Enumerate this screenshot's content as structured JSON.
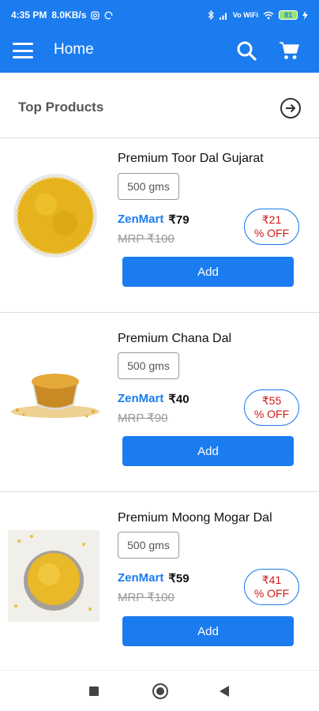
{
  "status_bar": {
    "time": "4:35 PM",
    "speed": "8.0KB/s",
    "network": "Vo WiFi",
    "battery": "81"
  },
  "app_bar": {
    "title": "Home"
  },
  "section": {
    "title": "Top Products"
  },
  "colors": {
    "primary": "#1b7cf0",
    "discount": "#d01818"
  },
  "products": [
    {
      "name": "Premium Toor Dal Gujarat",
      "weight": "500 gms",
      "brand": "ZenMart",
      "price": "₹79",
      "mrp": "MRP ₹100",
      "discount_amount": "₹21",
      "discount_label": "% OFF",
      "add_label": "Add"
    },
    {
      "name": "Premium Chana Dal",
      "weight": "500 gms",
      "brand": "ZenMart",
      "price": "₹40",
      "mrp": "MRP ₹90",
      "discount_amount": "₹55",
      "discount_label": "% OFF",
      "add_label": "Add"
    },
    {
      "name": "Premium Moong Mogar Dal",
      "weight": "500 gms",
      "brand": "ZenMart",
      "price": "₹59",
      "mrp": "MRP ₹100",
      "discount_amount": "₹41",
      "discount_label": "% OFF",
      "add_label": "Add"
    }
  ],
  "nav_bar": {
    "icons": [
      "recents-icon",
      "home-icon",
      "back-icon"
    ]
  }
}
